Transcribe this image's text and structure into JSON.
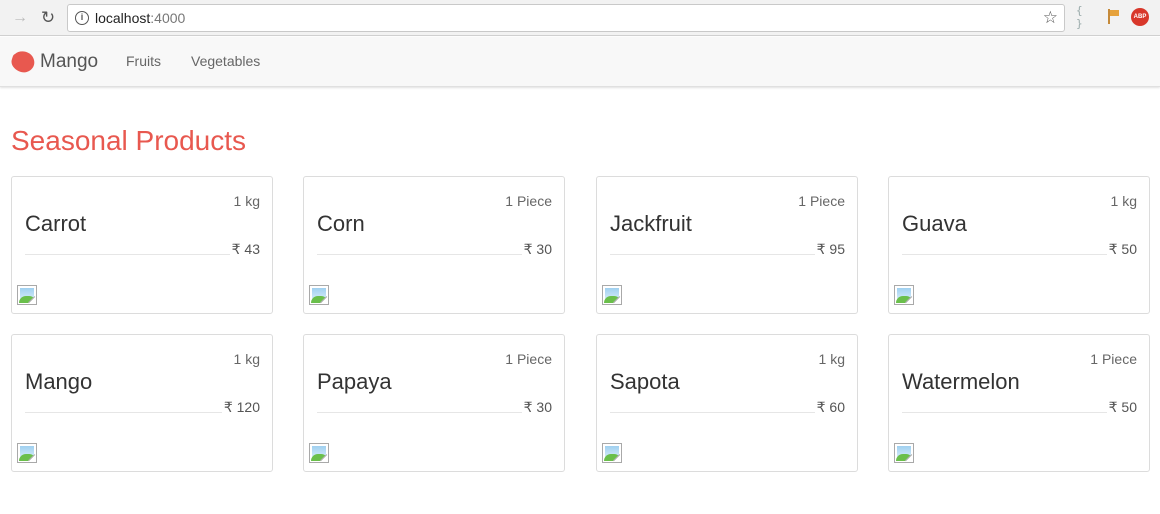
{
  "browser": {
    "url_host": "localhost",
    "url_port": ":4000",
    "icons": [
      "back-arrow-icon",
      "reload-icon",
      "info-icon",
      "star-icon",
      "json-viewer-icon",
      "flag-extension-icon",
      "adblock-plus-icon"
    ],
    "abp_label": "ABP",
    "json_label": "{ }"
  },
  "navbar": {
    "brand": "Mango",
    "links": [
      "Fruits",
      "Vegetables"
    ],
    "logo_color": "#e8584f"
  },
  "main": {
    "title": "Seasonal Products",
    "title_color": "#e8584f",
    "products": [
      {
        "name": "Carrot",
        "quantity": "1 kg",
        "price": "₹ 43"
      },
      {
        "name": "Corn",
        "quantity": "1 Piece",
        "price": "₹ 30"
      },
      {
        "name": "Jackfruit",
        "quantity": "1 Piece",
        "price": "₹ 95"
      },
      {
        "name": "Guava",
        "quantity": "1 kg",
        "price": "₹ 50"
      },
      {
        "name": "Mango",
        "quantity": "1 kg",
        "price": "₹ 120"
      },
      {
        "name": "Papaya",
        "quantity": "1 Piece",
        "price": "₹ 30"
      },
      {
        "name": "Sapota",
        "quantity": "1 kg",
        "price": "₹ 60"
      },
      {
        "name": "Watermelon",
        "quantity": "1 Piece",
        "price": "₹ 50"
      }
    ]
  }
}
